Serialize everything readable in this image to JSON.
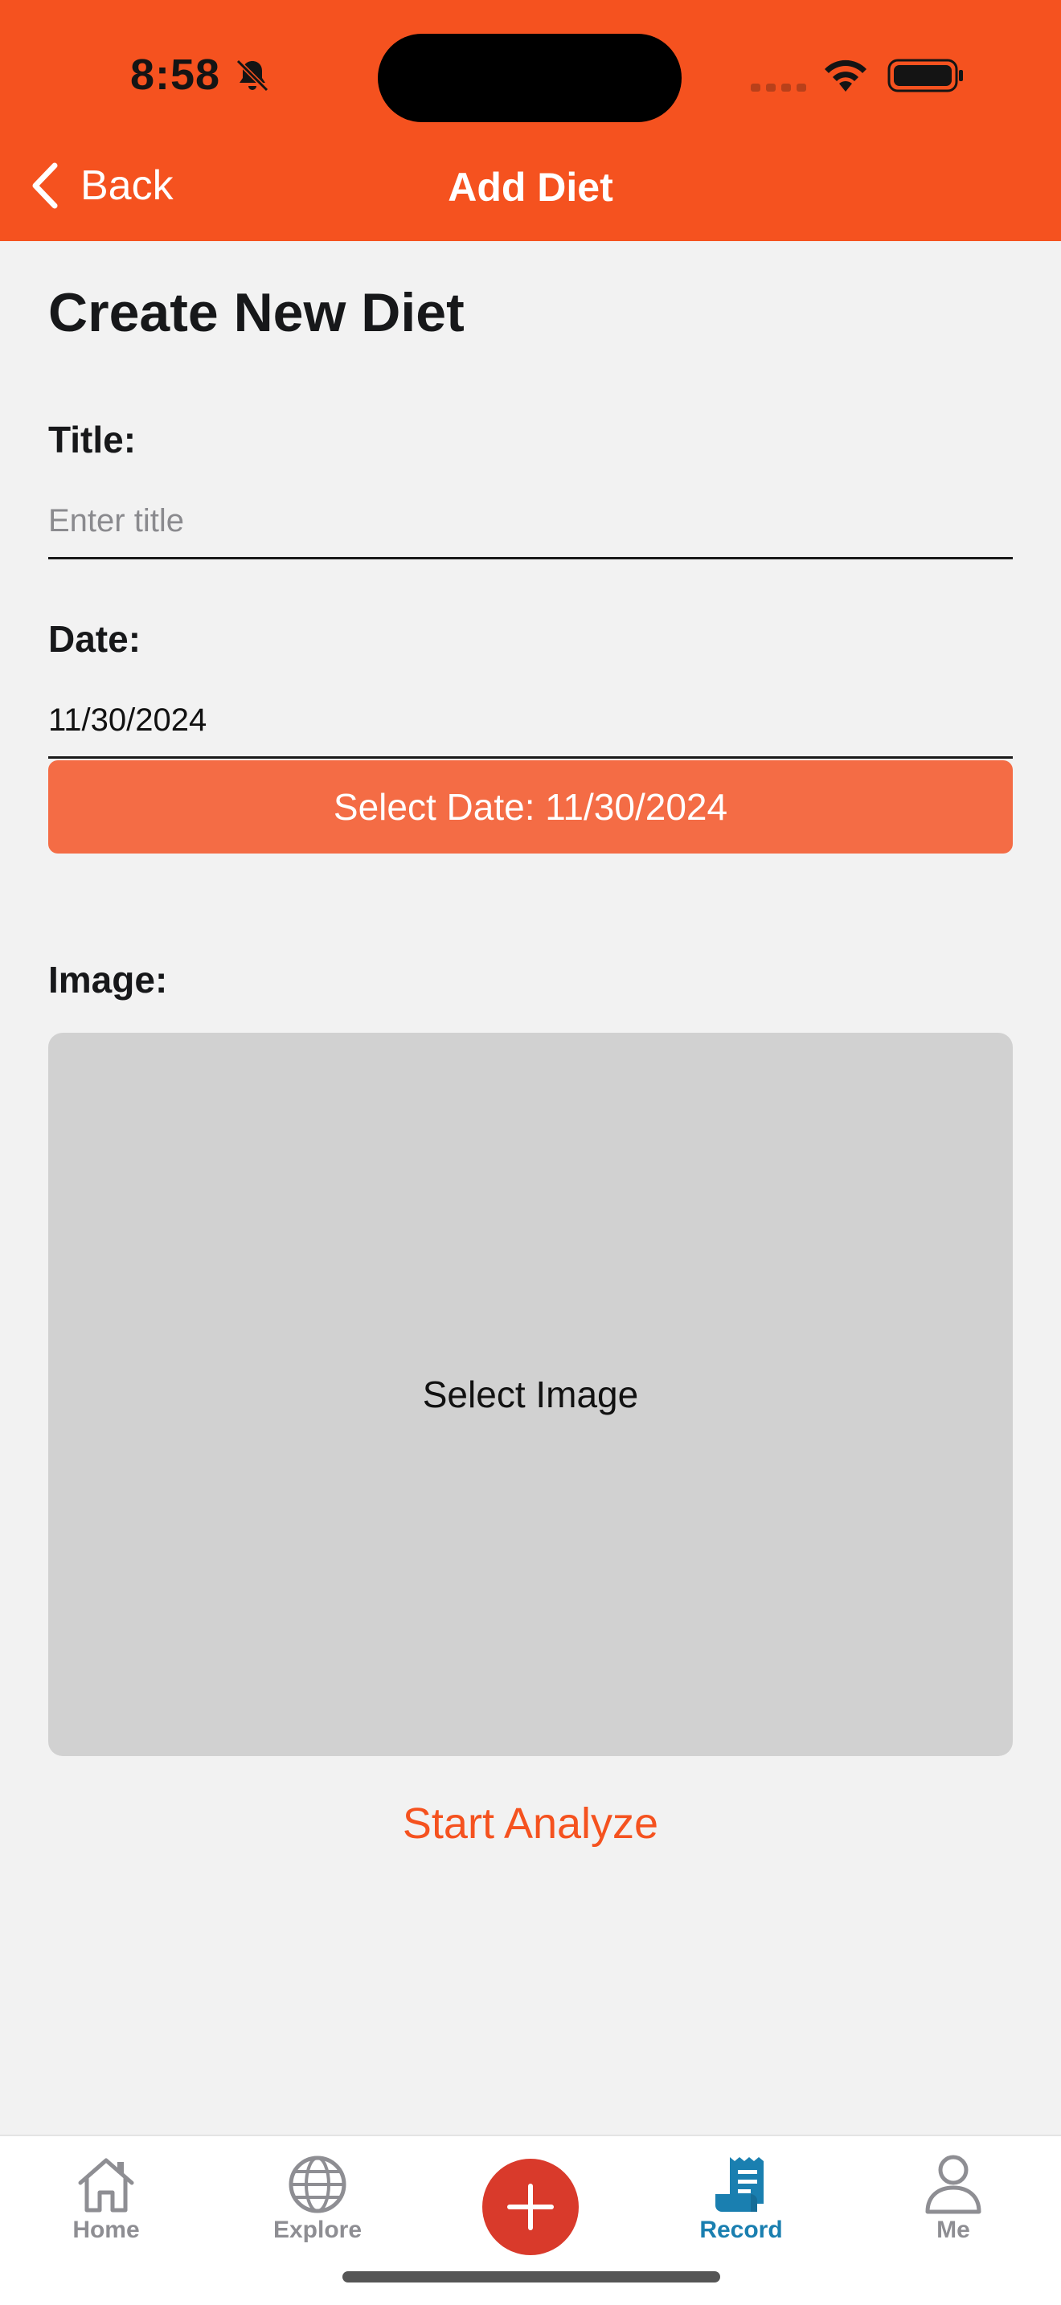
{
  "status_bar": {
    "time": "8:58",
    "icons": [
      "bell-slash-icon",
      "signal-icon",
      "wifi-icon",
      "battery-icon"
    ]
  },
  "nav": {
    "back_label": "Back",
    "title": "Add Diet"
  },
  "form": {
    "heading": "Create New Diet",
    "title_label": "Title:",
    "title_value": "",
    "title_placeholder": "Enter title",
    "date_label": "Date:",
    "date_value": "11/30/2024",
    "select_date_button": "Select Date: 11/30/2024",
    "image_label": "Image:",
    "select_image_label": "Select Image",
    "analyze_button": "Start Analyze"
  },
  "tab_bar": {
    "tabs": [
      {
        "label": "Home",
        "icon": "home-icon",
        "active": false
      },
      {
        "label": "Explore",
        "icon": "globe-icon",
        "active": false
      },
      {
        "label": "",
        "icon": "plus-icon",
        "active": false
      },
      {
        "label": "Record",
        "icon": "receipt-icon",
        "active": true
      },
      {
        "label": "Me",
        "icon": "person-icon",
        "active": false
      }
    ]
  },
  "colors": {
    "brand": "#f5521f",
    "date_button": "#f46c45",
    "image_placeholder": "#d1d1d1",
    "add_button": "#d93a2b",
    "active_tab": "#1a7fb0",
    "inactive_tab": "#8e8e93"
  }
}
